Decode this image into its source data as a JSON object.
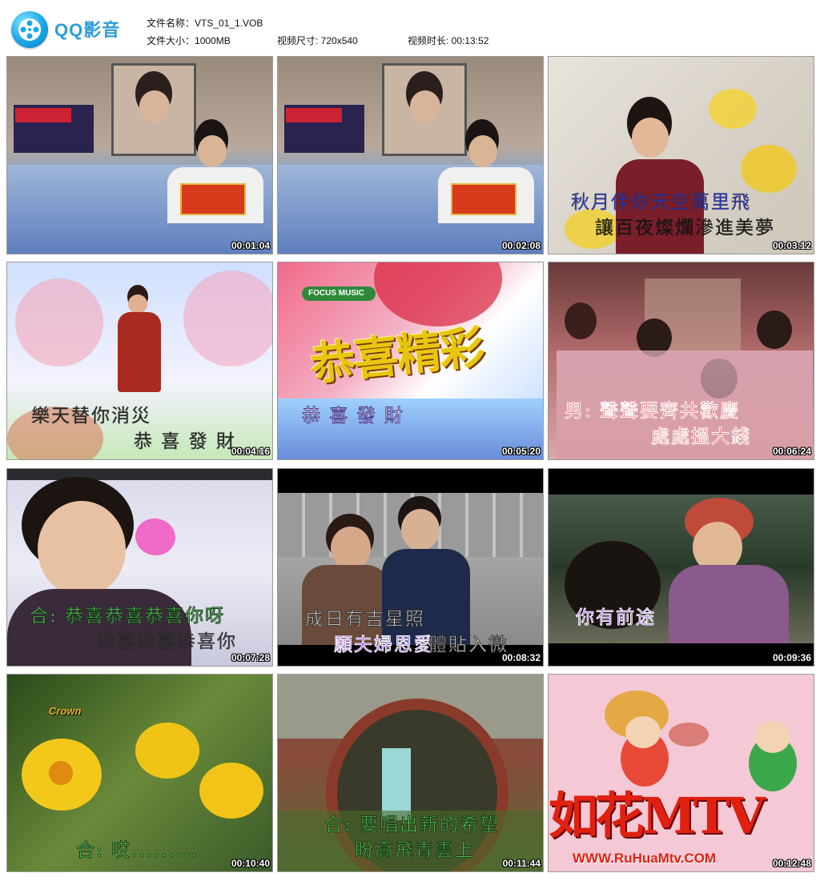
{
  "app": {
    "name": "QQ影音"
  },
  "info": {
    "filename_label": "文件名称：",
    "filename": "VTS_01_1.VOB",
    "size_label": "文件大小：",
    "size": "1000MB",
    "dims_label": "视频尺寸: ",
    "dims": "720x540",
    "duration_label": "视频时长: ",
    "duration": "00:13:52"
  },
  "thumbs": [
    {
      "time": "00:01:04",
      "line1": "",
      "line2": ""
    },
    {
      "time": "00:02:08",
      "line1": "",
      "line2": ""
    },
    {
      "time": "00:03:12",
      "line1": "秋月伴你天空萬里飛",
      "line2": "讓百夜燦爛滲進美夢"
    },
    {
      "time": "00:04:16",
      "line1": "樂天替你消災",
      "line2": "恭 喜 發 財"
    },
    {
      "time": "00:05:20",
      "line1": "恭 喜 發 財",
      "line2": "",
      "badge": "FOCUS MUSIC",
      "title_art": "恭喜精彩"
    },
    {
      "time": "00:06:24",
      "line1": "男: 聲聲要齊共歡慶",
      "line2": "處處搵大錢"
    },
    {
      "time": "00:07:28",
      "line1": "合: 恭喜恭喜恭喜你呀",
      "line2": "恭喜恭喜恭喜你"
    },
    {
      "time": "00:08:32",
      "line1": "成日有吉星照",
      "line2a": "願夫婦恩愛",
      "line2b": "體貼入微"
    },
    {
      "time": "00:09:36",
      "line1": "你有前途",
      "line2": ""
    },
    {
      "time": "00:10:40",
      "line1": "合: 哎.........",
      "line2": "",
      "logo": "Crown"
    },
    {
      "time": "00:11:44",
      "line1": "合: 要唱出新的希望",
      "line2": "盼高飛青雲上"
    },
    {
      "time": "00:12:48",
      "line1": "",
      "line2": "",
      "watermark": "如花MTV",
      "url": "WWW.RuHuaMtv.COM"
    }
  ]
}
